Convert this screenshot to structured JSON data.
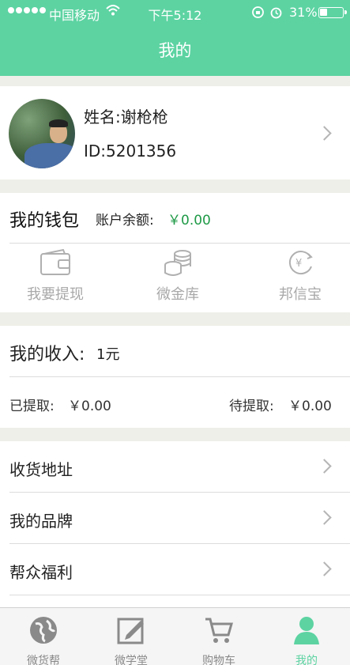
{
  "status_bar": {
    "carrier": "中国移动",
    "time": "下午5:12",
    "battery": "31%"
  },
  "header": {
    "title": "我的"
  },
  "profile": {
    "name": "姓名:谢枪枪",
    "id": "ID:5201356"
  },
  "wallet": {
    "title": "我的钱包",
    "balance_label": "账户余额:",
    "balance_value": "￥0.00",
    "actions": [
      {
        "label": "我要提现",
        "icon": "wallet-icon"
      },
      {
        "label": "微金库",
        "icon": "coins-icon"
      },
      {
        "label": "邦信宝",
        "icon": "yen-cycle-icon"
      }
    ]
  },
  "income": {
    "title": "我的收入:",
    "value": "1元",
    "withdrawn_label": "已提取:",
    "withdrawn_value": "￥0.00",
    "pending_label": "待提取:",
    "pending_value": "￥0.00"
  },
  "menu": [
    {
      "label": "收货地址"
    },
    {
      "label": "我的品牌"
    },
    {
      "label": "帮众福利"
    }
  ],
  "tabbar": [
    {
      "label": "微货帮",
      "icon": "globe-icon",
      "active": false
    },
    {
      "label": "微学堂",
      "icon": "edit-icon",
      "active": false
    },
    {
      "label": "购物车",
      "icon": "cart-icon",
      "active": false
    },
    {
      "label": "我的",
      "icon": "person-icon",
      "active": true
    }
  ],
  "colors": {
    "accent": "#5dd3a2",
    "balance": "#1f9a47",
    "background": "#efefe9"
  }
}
